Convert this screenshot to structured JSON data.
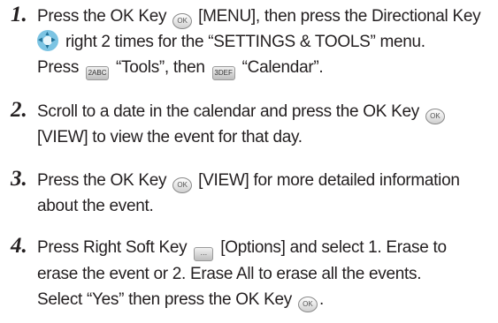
{
  "steps": [
    {
      "number": "1.",
      "lines": [
        [
          "Press the OK Key ",
          {
            "icon": "ok-key-icon",
            "text": "OK"
          },
          " [MENU], then press the Directional Key"
        ],
        [
          {
            "icon": "directional-key-icon"
          },
          " right 2 times for the “SETTINGS & TOOLS” menu."
        ],
        [
          "Press ",
          {
            "icon": "key-2-icon",
            "text": "2ABC"
          },
          " “Tools”, then ",
          {
            "icon": "key-3-icon",
            "text": "3DEF"
          },
          " “Calendar”."
        ]
      ]
    },
    {
      "number": "2.",
      "lines": [
        [
          "Scroll to a date in the calendar and press the OK Key ",
          {
            "icon": "ok-key-icon",
            "text": "OK"
          }
        ],
        [
          "[VIEW] to view the event for that day."
        ]
      ]
    },
    {
      "number": "3.",
      "lines": [
        [
          "Press the OK Key ",
          {
            "icon": "ok-key-icon",
            "text": "OK"
          },
          " [VIEW] for more detailed information"
        ],
        [
          "about the event."
        ]
      ]
    },
    {
      "number": "4.",
      "lines": [
        [
          "Press Right Soft Key ",
          {
            "icon": "right-soft-key-icon",
            "text": "…"
          },
          " [Options] and select 1. Erase to"
        ],
        [
          "erase the event or 2. Erase All to erase all the events."
        ],
        [
          "Select “Yes” then press the OK Key ",
          {
            "icon": "ok-key-icon",
            "text": "OK"
          },
          "."
        ]
      ]
    }
  ]
}
